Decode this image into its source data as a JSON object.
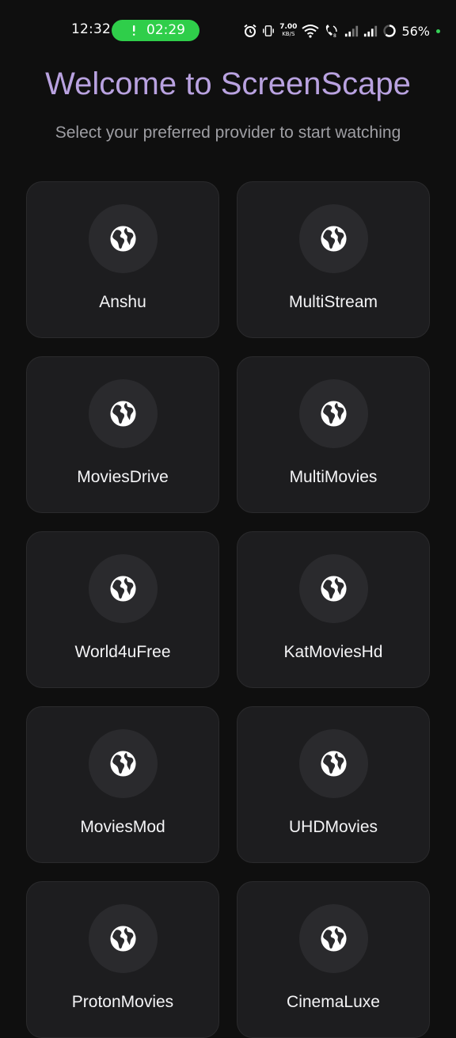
{
  "status_bar": {
    "time": "12:32",
    "call_timer": "02:29",
    "net_speed_value": "7.00",
    "net_speed_unit": "KB/S",
    "battery": "56%",
    "icons": [
      "alarm-icon",
      "vibrate-icon",
      "wifi-icon",
      "volte-icon",
      "signal-icon",
      "signal-icon",
      "battery-ring-icon"
    ]
  },
  "header": {
    "title": "Welcome to ScreenScape",
    "subtitle": "Select your preferred provider to start watching"
  },
  "providers": [
    {
      "name": "Anshu",
      "icon": "globe-icon"
    },
    {
      "name": "MultiStream",
      "icon": "globe-icon"
    },
    {
      "name": "MoviesDrive",
      "icon": "globe-icon"
    },
    {
      "name": "MultiMovies",
      "icon": "globe-icon"
    },
    {
      "name": "World4uFree",
      "icon": "globe-icon"
    },
    {
      "name": "KatMoviesHd",
      "icon": "globe-icon"
    },
    {
      "name": "MoviesMod",
      "icon": "globe-icon"
    },
    {
      "name": "UHDMovies",
      "icon": "globe-icon"
    },
    {
      "name": "ProtonMovies",
      "icon": "globe-icon"
    },
    {
      "name": "CinemaLuxe",
      "icon": "globe-icon"
    }
  ],
  "colors": {
    "background": "#0f0f0f",
    "title": "#b9a2e0",
    "card": "#1d1d1f",
    "icon_circle": "#2a2a2d",
    "call_pill": "#2fce4a"
  }
}
